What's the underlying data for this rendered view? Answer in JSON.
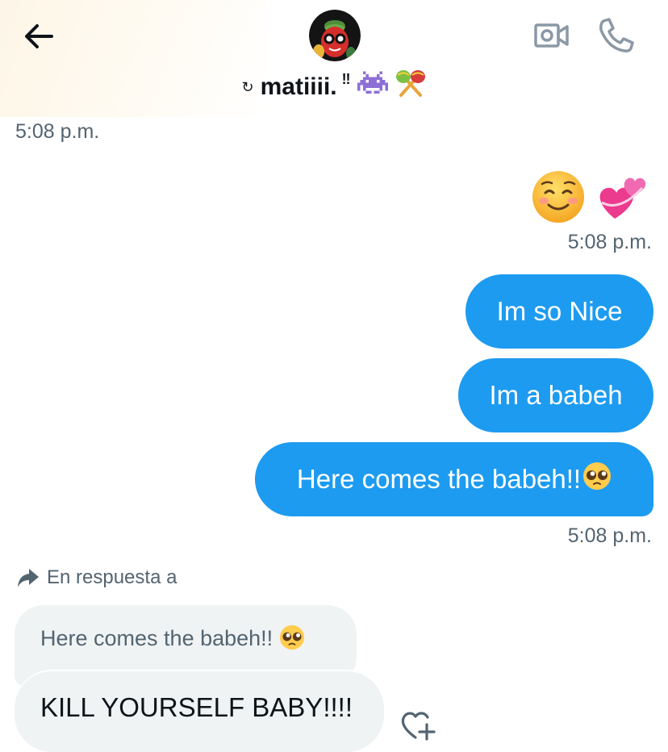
{
  "header": {
    "contact_prefix": "↻",
    "contact_name": "matiiii.",
    "contact_suffix": "‼",
    "name_emojis": [
      "alien-monster-emoji",
      "maracas-emoji"
    ],
    "icons": {
      "back": "back-arrow-icon",
      "video": "video-call-icon",
      "phone": "phone-call-icon"
    }
  },
  "messages": {
    "first_time": "5:08 p.m.",
    "sent_emojis": [
      "smiling-face-emoji",
      "revolving-hearts-emoji"
    ],
    "emoji_time": "5:08 p.m.",
    "sent_1": "Im so Nice",
    "sent_2": "Im a babeh",
    "sent_3": "Here comes the babeh!!",
    "sent_3_emoji": "pleading-face-emoji",
    "sent_time": "5:08 p.m.",
    "reply_label": "En respuesta a",
    "quoted_text": "Here comes the babeh!!",
    "quoted_emoji": "pleading-face-emoji",
    "received_1": "KILL YOURSELF BABY!!!!"
  },
  "colors": {
    "sent_bubble": "#1d9bf0",
    "received_bubble": "#eff3f4",
    "secondary_text": "#536471"
  }
}
